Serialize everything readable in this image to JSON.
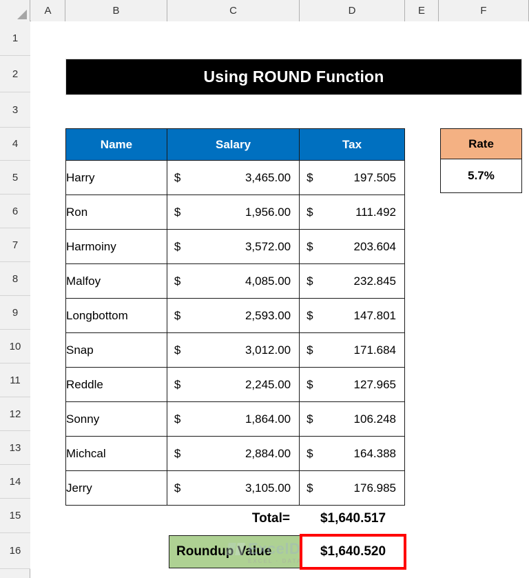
{
  "app": {
    "type": "spreadsheet",
    "select_all_icon": "select-all-triangle-icon"
  },
  "grid": {
    "column_headers": [
      "A",
      "B",
      "C",
      "D",
      "E",
      "F"
    ],
    "row_headers": [
      "1",
      "2",
      "3",
      "4",
      "5",
      "6",
      "7",
      "8",
      "9",
      "10",
      "11",
      "12",
      "13",
      "14",
      "15",
      "16"
    ]
  },
  "title_banner": {
    "text": "Using ROUND Function",
    "background": "#000000",
    "color": "#ffffff"
  },
  "table": {
    "headers": [
      "Name",
      "Salary",
      "Tax"
    ],
    "header_background": "#0070C0",
    "header_color": "#FFFFFF",
    "currency_symbol": "$",
    "rows": [
      {
        "name": "Harry",
        "salary": "3,465.00",
        "tax": "197.505"
      },
      {
        "name": "Ron",
        "salary": "1,956.00",
        "tax": "111.492"
      },
      {
        "name": "Harmoiny",
        "salary": "3,572.00",
        "tax": "203.604"
      },
      {
        "name": "Malfoy",
        "salary": "4,085.00",
        "tax": "232.845"
      },
      {
        "name": "Longbottom",
        "salary": "2,593.00",
        "tax": "147.801"
      },
      {
        "name": "Snap",
        "salary": "3,012.00",
        "tax": "171.684"
      },
      {
        "name": "Reddle",
        "salary": "2,245.00",
        "tax": "127.965"
      },
      {
        "name": "Sonny",
        "salary": "1,864.00",
        "tax": "106.248"
      },
      {
        "name": "Michcal",
        "salary": "2,884.00",
        "tax": "164.388"
      },
      {
        "name": "Jerry",
        "salary": "3,105.00",
        "tax": "176.985"
      }
    ]
  },
  "rate_box": {
    "label": "Rate",
    "value": "5.7%",
    "header_background": "#F4B183"
  },
  "total": {
    "label": "Total=",
    "value": "$1,640.517"
  },
  "roundup": {
    "label": "Roundup Value",
    "value": "$1,640.520",
    "label_background": "#AED193",
    "highlight_border": "#FF0000"
  },
  "watermark": {
    "name": "ExcelDemy",
    "tagline": "EXCEL · DATA · BI"
  }
}
